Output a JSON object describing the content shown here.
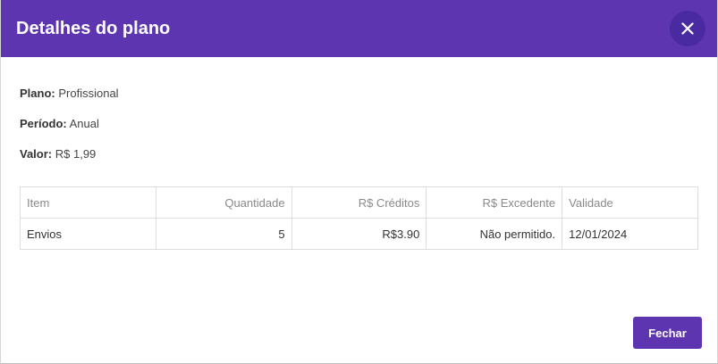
{
  "modal": {
    "title": "Detalhes do plano",
    "close_icon": "close-icon"
  },
  "details": {
    "plano_label": "Plano:",
    "plano_value": "Profissional",
    "periodo_label": "Período:",
    "periodo_value": "Anual",
    "valor_label": "Valor:",
    "valor_value": "R$ 1,99"
  },
  "table": {
    "headers": [
      "Item",
      "Quantidade",
      "R$ Créditos",
      "R$ Excedente",
      "Validade"
    ],
    "rows": [
      [
        "Envios",
        "5",
        "R$3.90",
        "Não permitido.",
        "12/01/2024"
      ]
    ]
  },
  "footer": {
    "close_label": "Fechar"
  },
  "colors": {
    "accent": "#5e35b1",
    "close_circle": "#4a2aa0"
  }
}
